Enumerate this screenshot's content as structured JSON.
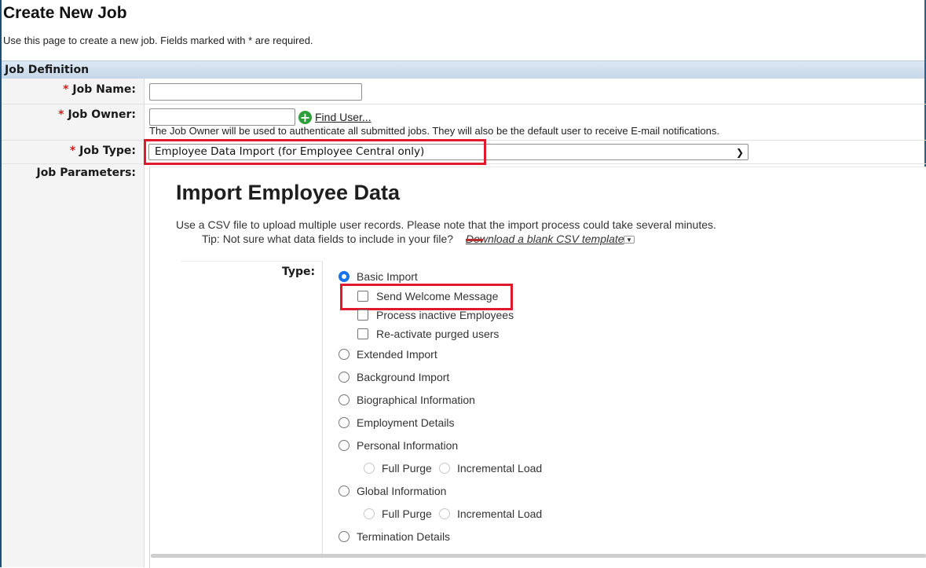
{
  "page": {
    "title": "Create New Job",
    "description": "Use this page to create a new job. Fields marked with * are required."
  },
  "job_definition": {
    "header": "Job Definition",
    "required_mark": "*",
    "job_name_label": "Job Name:",
    "job_name_value": "",
    "job_owner_label": "Job Owner:",
    "job_owner_value": "",
    "find_user": "Find User...",
    "owner_help": "The Job Owner will be used to authenticate all submitted jobs. They will also be the default user to receive E-mail notifications.",
    "job_type_label": "Job Type:",
    "job_type_value": "Employee Data Import (for Employee Central only)",
    "job_parameters_label": "Job Parameters:"
  },
  "import": {
    "title": "Import Employee Data",
    "description": "Use a CSV file to upload multiple user records. Please note that the import process could take several minutes.",
    "tip": "Tip: Not sure what data fields to include in your file?",
    "download_link": "Download a blank CSV template",
    "type_label": "Type:",
    "options": {
      "basic_import": "Basic Import",
      "send_welcome_message": "Send Welcome Message",
      "process_inactive": "Process inactive Employees",
      "reactivate_purged": "Re-activate purged users",
      "extended_import": "Extended Import",
      "background_import": "Background Import",
      "biographical_information": "Biographical Information",
      "employment_details": "Employment Details",
      "personal_information": "Personal Information",
      "global_information": "Global Information",
      "termination_details": "Termination Details",
      "full_purge": "Full Purge",
      "incremental_load": "Incremental Load"
    }
  },
  "colors": {
    "highlight": "#e0192d",
    "section_header": "#c7d7e8",
    "radio_selected": "#1a73e8"
  }
}
